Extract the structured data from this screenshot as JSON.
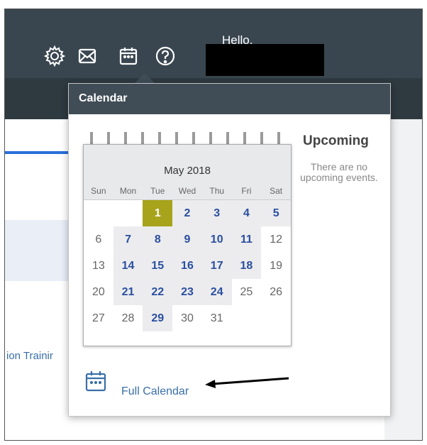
{
  "header": {
    "greeting": "Hello,",
    "icons": [
      "settings-icon",
      "mail-icon",
      "calendar-icon",
      "help-icon"
    ]
  },
  "page": {
    "link_text": "ion Trainir"
  },
  "calendar_popup": {
    "title": "Calendar",
    "month_label": "May 2018",
    "weekdays": [
      "Sun",
      "Mon",
      "Tue",
      "Wed",
      "Thu",
      "Fri",
      "Sat"
    ],
    "days": [
      {
        "d": "",
        "t": "empty"
      },
      {
        "d": "",
        "t": "empty"
      },
      {
        "d": "1",
        "t": "today"
      },
      {
        "d": "2",
        "t": "wk"
      },
      {
        "d": "3",
        "t": "wk"
      },
      {
        "d": "4",
        "t": "wk"
      },
      {
        "d": "5",
        "t": "wk"
      },
      {
        "d": "6",
        "t": "we"
      },
      {
        "d": "7",
        "t": "wk"
      },
      {
        "d": "8",
        "t": "wk"
      },
      {
        "d": "9",
        "t": "wk"
      },
      {
        "d": "10",
        "t": "wk"
      },
      {
        "d": "11",
        "t": "wk"
      },
      {
        "d": "12",
        "t": "we"
      },
      {
        "d": "13",
        "t": "we"
      },
      {
        "d": "14",
        "t": "wk"
      },
      {
        "d": "15",
        "t": "wk"
      },
      {
        "d": "16",
        "t": "wk"
      },
      {
        "d": "17",
        "t": "wk"
      },
      {
        "d": "18",
        "t": "wk"
      },
      {
        "d": "19",
        "t": "we"
      },
      {
        "d": "20",
        "t": "we"
      },
      {
        "d": "21",
        "t": "wk"
      },
      {
        "d": "22",
        "t": "wk"
      },
      {
        "d": "23",
        "t": "wk"
      },
      {
        "d": "24",
        "t": "wk"
      },
      {
        "d": "25",
        "t": "we"
      },
      {
        "d": "26",
        "t": "we"
      },
      {
        "d": "27",
        "t": "we"
      },
      {
        "d": "28",
        "t": "we"
      },
      {
        "d": "29",
        "t": "wk"
      },
      {
        "d": "30",
        "t": "we"
      },
      {
        "d": "31",
        "t": "we"
      }
    ],
    "upcoming_title": "Upcoming",
    "upcoming_text": "There are no upcoming events.",
    "full_calendar_label": "Full Calendar"
  },
  "colors": {
    "topbar": "#394650",
    "accent_blue": "#2a6fdb",
    "today": "#a7a31b",
    "link": "#3a6fa8"
  }
}
